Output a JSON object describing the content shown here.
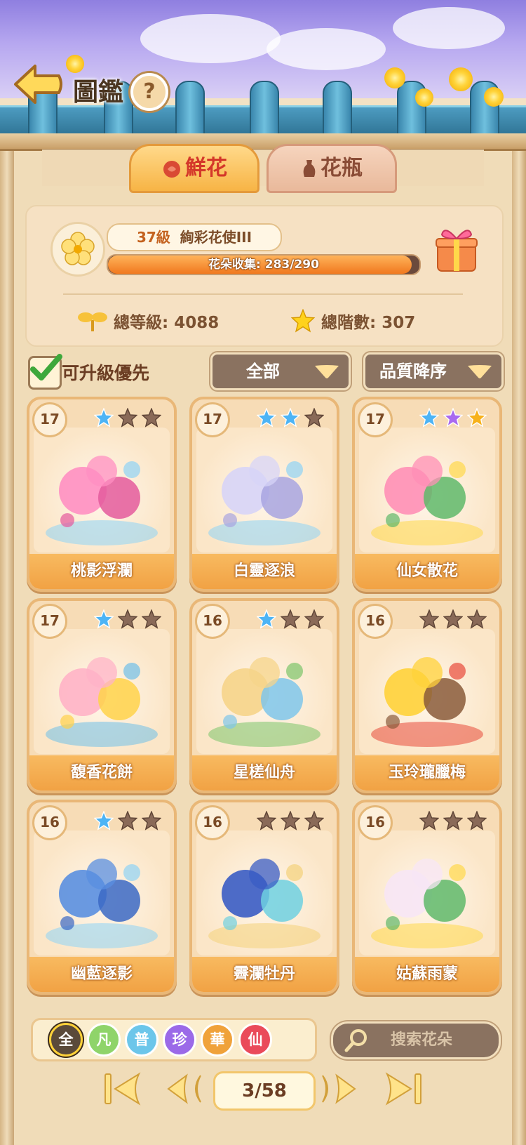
{
  "header": {
    "title": "圖鑑",
    "help_label": "?"
  },
  "tabs": [
    {
      "label": "鮮花",
      "active": true,
      "icon": "rose-icon"
    },
    {
      "label": "花瓶",
      "active": false,
      "icon": "vase-icon"
    }
  ],
  "summary": {
    "level_num": "37級",
    "level_title": "絢彩花使III",
    "progress_text": "花朵收集: 283/290",
    "progress_fraction": 0.976,
    "total_level": "總等級: 4088",
    "total_rank": "總階數: 307"
  },
  "filters": {
    "upgrade_first_label": "可升級優先",
    "upgrade_first_checked": true,
    "category": "全部",
    "sort": "品質降序"
  },
  "cards": [
    {
      "name": "桃影浮瀾",
      "level": "17",
      "stars": [
        "blue",
        "empty",
        "empty"
      ],
      "art": "pink-dolphin-art"
    },
    {
      "name": "白靈逐浪",
      "level": "17",
      "stars": [
        "blue",
        "blue",
        "empty"
      ],
      "art": "white-dolphin-art"
    },
    {
      "name": "仙女散花",
      "level": "17",
      "stars": [
        "blue",
        "purple",
        "gold"
      ],
      "art": "lotus-art"
    },
    {
      "name": "馥香花餅",
      "level": "17",
      "stars": [
        "blue",
        "empty",
        "empty"
      ],
      "art": "flower-cake-art"
    },
    {
      "name": "星槎仙舟",
      "level": "16",
      "stars": [
        "blue",
        "empty",
        "empty"
      ],
      "art": "fairy-boat-art"
    },
    {
      "name": "玉玲瓏臘梅",
      "level": "16",
      "stars": [
        "empty",
        "empty",
        "empty"
      ],
      "art": "wintersweet-art"
    },
    {
      "name": "幽藍逐影",
      "level": "16",
      "stars": [
        "blue",
        "empty",
        "empty"
      ],
      "art": "blue-dolphin-art"
    },
    {
      "name": "霽瀾牡丹",
      "level": "16",
      "stars": [
        "empty",
        "empty",
        "empty"
      ],
      "art": "blue-peony-art"
    },
    {
      "name": "姑蘇雨蒙",
      "level": "16",
      "stars": [
        "empty",
        "empty",
        "empty"
      ],
      "art": "white-lotus-art"
    }
  ],
  "rarity_chips": [
    {
      "label": "全",
      "color": "#5a4a3a",
      "selected": true
    },
    {
      "label": "凡",
      "color": "#8fd46a",
      "selected": false
    },
    {
      "label": "普",
      "color": "#6cc6ea",
      "selected": false
    },
    {
      "label": "珍",
      "color": "#9b6ae8",
      "selected": false
    },
    {
      "label": "華",
      "color": "#f0a23a",
      "selected": false
    },
    {
      "label": "仙",
      "color": "#ea4a5a",
      "selected": false
    }
  ],
  "search": {
    "placeholder": "搜索花朵"
  },
  "pagination": {
    "text": "3/58"
  },
  "colors": {
    "accent": "#f1a244",
    "star_blue": "#4db4f5",
    "star_purple": "#a96af0",
    "star_gold": "#f7b21c",
    "star_empty": "#8a6a58"
  }
}
